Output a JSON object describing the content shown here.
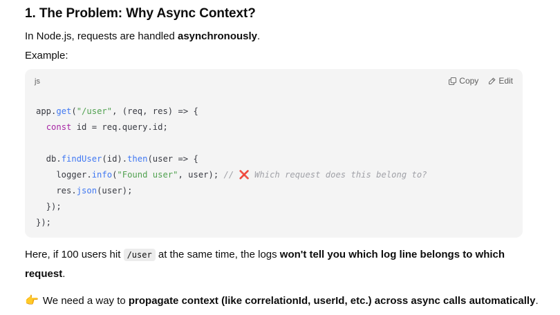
{
  "heading": "1. The Problem: Why Async Context?",
  "intro": {
    "before": "In Node.js, requests are handled ",
    "bold": "asynchronously",
    "after": "."
  },
  "example_label": "Example:",
  "code_block": {
    "language": "js",
    "copy_label": "Copy",
    "edit_label": "Edit",
    "lines": [
      "app.get(\"/user\", (req, res) => {",
      "  const id = req.query.id;",
      "",
      "  db.findUser(id).then(user => {",
      "    logger.info(\"Found user\", user); // ❌ Which request does this belong to?",
      "    res.json(user);",
      "  });",
      "});"
    ]
  },
  "para2": {
    "before": "Here, if 100 users hit ",
    "code": "/user",
    "middle": " at the same time, the logs ",
    "bold": "won't tell you which log line belongs to which request",
    "after": "."
  },
  "para3": {
    "icon": "pointing-hand-icon",
    "before": "We need a way to ",
    "bold": "propagate context (like correlationId, userId, etc.) across async calls automatically",
    "after": "."
  },
  "colors": {
    "code_bg": "#f4f4f4",
    "function": "#4078f2",
    "string": "#50a14f",
    "keyword": "#a626a4",
    "comment": "#a0a1a7",
    "cross": "#d9353d"
  }
}
